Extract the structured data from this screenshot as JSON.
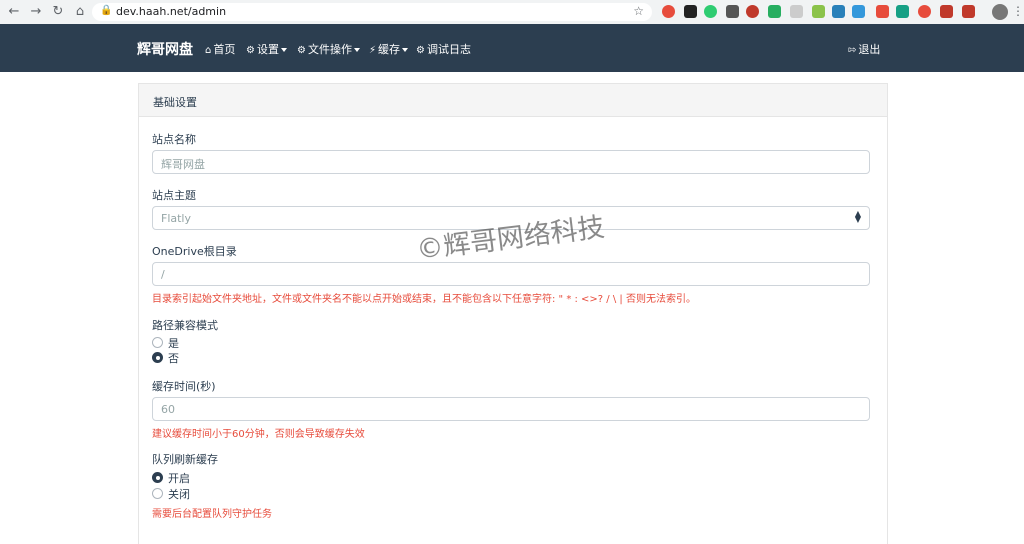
{
  "browser": {
    "url": "dev.haah.net/admin"
  },
  "navbar": {
    "brand": "辉哥网盘",
    "items": [
      {
        "label": "首页",
        "icon": "home-icon"
      },
      {
        "label": "设置",
        "icon": "gear-icon",
        "dropdown": true
      },
      {
        "label": "文件操作",
        "icon": "gears-icon",
        "dropdown": true
      },
      {
        "label": "缓存",
        "icon": "bolt-icon",
        "dropdown": true
      },
      {
        "label": "调试日志",
        "icon": "bug-icon"
      }
    ],
    "logout": "退出"
  },
  "card": {
    "title": "基础设置"
  },
  "form": {
    "site_name": {
      "label": "站点名称",
      "placeholder": "辉哥网盘"
    },
    "site_theme": {
      "label": "站点主题",
      "value": "Flatly"
    },
    "onedrive_root": {
      "label": "OneDrive根目录",
      "placeholder": "/",
      "help": "目录索引起始文件夹地址，文件或文件夹名不能以点开始或结束，且不能包含以下任意字符: \" * : <>? / \\ | 否则无法索引。"
    },
    "path_compat": {
      "label": "路径兼容模式",
      "options": [
        "是",
        "否"
      ],
      "selected": "否"
    },
    "cache_time": {
      "label": "缓存时间(秒)",
      "placeholder": "60",
      "help": "建议缓存时间小于60分钟，否则会导致缓存失效"
    },
    "queue_refresh": {
      "label": "队列刷新缓存",
      "options": [
        "开启",
        "关闭"
      ],
      "selected": "开启",
      "help": "需要后台配置队列守护任务"
    }
  },
  "watermark": "©辉哥网络科技",
  "colors": {
    "navbar": "#2c3e50",
    "help_text": "#e74c3c",
    "primary": "#2c3e50"
  }
}
